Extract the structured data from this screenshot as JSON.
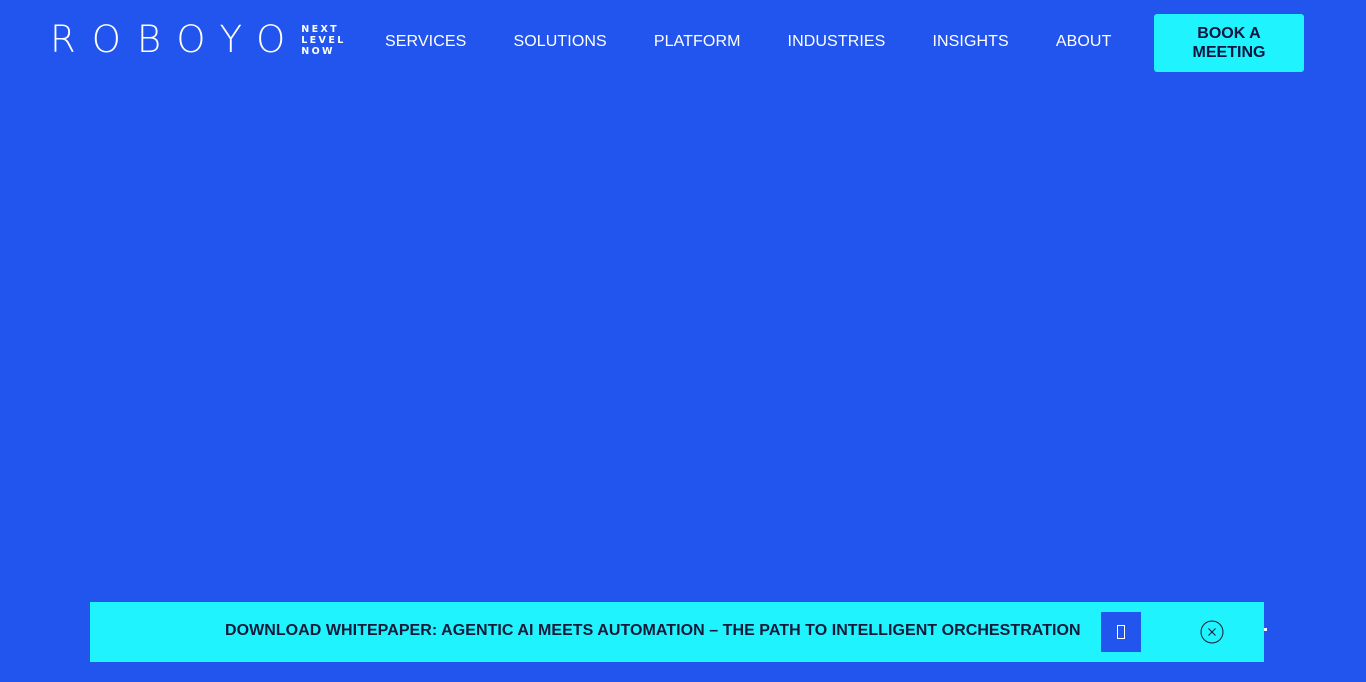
{
  "header": {
    "logo": {
      "wordmark": "ROBOYO",
      "tagline": [
        "NEXT",
        "LEVEL",
        "NOW"
      ]
    },
    "nav": [
      {
        "label": "SERVICES"
      },
      {
        "label": "SOLUTIONS"
      },
      {
        "label": "PLATFORM"
      },
      {
        "label": "INDUSTRIES"
      },
      {
        "label": "INSIGHTS"
      },
      {
        "label": "ABOUT"
      }
    ],
    "cta_label": "BOOK A MEETING"
  },
  "banner": {
    "text": "DOWNLOAD WHITEPAPER: AGENTIC AI MEETS AUTOMATION – THE PATH TO INTELLIGENT ORCHESTRATION",
    "thumbnail_icon": "whitepaper-cover-icon",
    "close_icon": "close-circle-icon"
  },
  "colors": {
    "background": "#2255ee",
    "accent": "#1ff3fe",
    "dark_text": "#141a3a",
    "light_text": "#ffffff"
  }
}
